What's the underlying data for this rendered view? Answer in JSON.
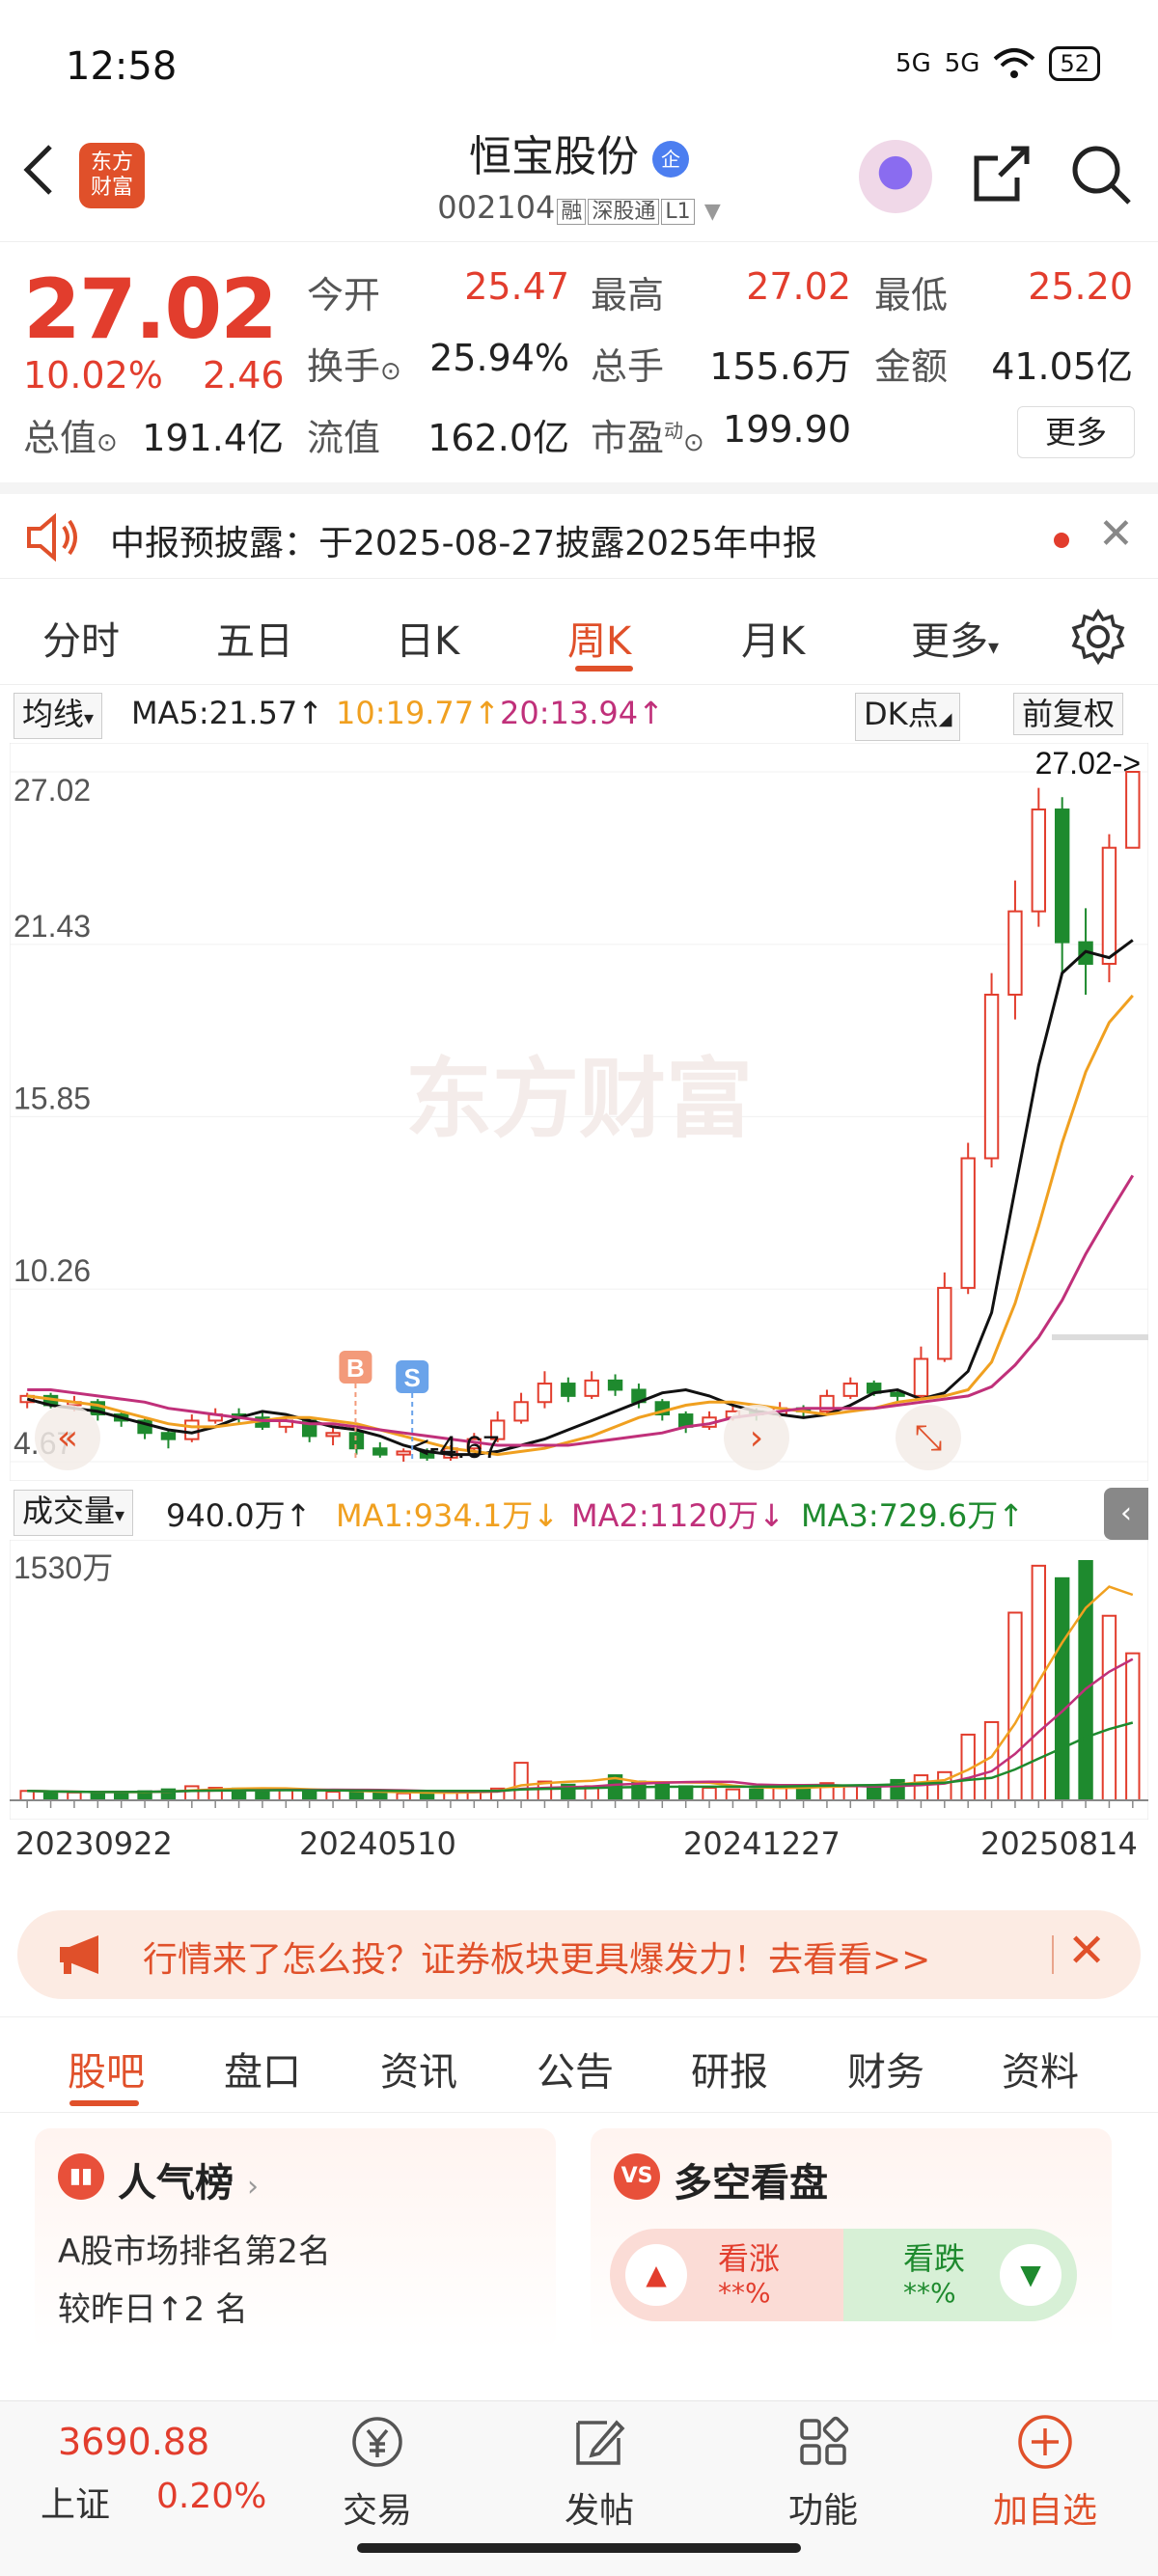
{
  "status": {
    "time": "12:58",
    "signal1": "5G",
    "signal2": "5G",
    "battery": "52"
  },
  "header": {
    "logo_line1": "东方",
    "logo_line2": "财富",
    "name": "恒宝股份",
    "name_badge": "企",
    "code": "002104",
    "tag_margin": "融",
    "tag_connect": "深股通",
    "tag_level": "L1"
  },
  "quote": {
    "last_price": "27.02",
    "pct_change": "10.02%",
    "change": "2.46",
    "open_label": "今开",
    "open": "25.47",
    "high_label": "最高",
    "high": "27.02",
    "low_label": "最低",
    "low": "25.20",
    "turnover_label": "换手",
    "turnover": "25.94%",
    "volume_label": "总手",
    "volume": "155.6万",
    "amount_label": "金额",
    "amount": "41.05亿",
    "mcap_label": "总值",
    "mcap": "191.4亿",
    "float_label": "流值",
    "float_mcap": "162.0亿",
    "pe_label": "市盈",
    "pe_sup": "动",
    "pe": "199.90",
    "more": "更多"
  },
  "notice": {
    "text": "中报预披露：于2025-08-27披露2025年中报"
  },
  "period_tabs": [
    "分时",
    "五日",
    "日K",
    "周K",
    "月K",
    "更多"
  ],
  "active_period": "周K",
  "ma_row": {
    "selector": "均线",
    "ma5": "MA5:21.57↑",
    "ma10": "10:19.77↑",
    "ma20": "20:13.94↑",
    "dk": "DK点",
    "adjust": "前复权"
  },
  "colors": {
    "up": "#e23d2d",
    "down": "#1e8a2e",
    "ma5": "#111111",
    "ma10": "#f0a020",
    "ma20": "#c0307a",
    "accent": "#e0502a"
  },
  "chart_data": [
    {
      "type": "candlestick",
      "title": "",
      "y_ticks": [
        "27.02",
        "21.43",
        "15.85",
        "10.26",
        "4.67"
      ],
      "ylim": [
        4.67,
        27.02
      ],
      "x_ticks": [
        "20230922",
        "20240510",
        "20241227",
        "20250814"
      ],
      "annotations": {
        "high_marker": "27.02->",
        "low_marker": "<-4.67",
        "buy": "B",
        "sell": "S"
      },
      "watermark": "东方财富",
      "series": [
        {
          "name": "MA5",
          "values": [
            6.7,
            6.5,
            6.4,
            6.3,
            6.1,
            5.9,
            5.7,
            5.6,
            5.8,
            6.1,
            6.3,
            6.2,
            6.0,
            5.8,
            5.7,
            5.5,
            5.2,
            5.0,
            4.9,
            4.9,
            5.0,
            5.2,
            5.4,
            5.7,
            6.0,
            6.3,
            6.6,
            6.9,
            7.0,
            6.8,
            6.5,
            6.3,
            6.2,
            6.1,
            6.2,
            6.5,
            6.9,
            7.0,
            6.7,
            6.9,
            7.6,
            9.5,
            13.5,
            17.5,
            20.5,
            21.2,
            21.0,
            21.57
          ]
        },
        {
          "name": "MA10",
          "values": [
            6.8,
            6.7,
            6.6,
            6.5,
            6.3,
            6.1,
            5.9,
            5.8,
            5.8,
            5.9,
            6.0,
            6.1,
            6.1,
            6.0,
            5.9,
            5.7,
            5.5,
            5.3,
            5.1,
            5.0,
            4.9,
            5.0,
            5.1,
            5.3,
            5.5,
            5.8,
            6.1,
            6.3,
            6.5,
            6.6,
            6.6,
            6.5,
            6.4,
            6.3,
            6.2,
            6.3,
            6.4,
            6.6,
            6.7,
            6.8,
            7.0,
            7.9,
            9.8,
            12.3,
            15.0,
            17.3,
            18.9,
            19.77
          ]
        },
        {
          "name": "MA20",
          "values": [
            7.0,
            7.0,
            6.9,
            6.8,
            6.7,
            6.6,
            6.4,
            6.3,
            6.2,
            6.1,
            6.0,
            6.0,
            5.9,
            5.9,
            5.8,
            5.7,
            5.6,
            5.5,
            5.4,
            5.3,
            5.2,
            5.2,
            5.2,
            5.2,
            5.3,
            5.4,
            5.5,
            5.6,
            5.8,
            5.9,
            6.1,
            6.2,
            6.3,
            6.4,
            6.4,
            6.4,
            6.4,
            6.5,
            6.6,
            6.7,
            6.8,
            7.1,
            7.8,
            8.7,
            9.9,
            11.4,
            12.7,
            13.94
          ]
        }
      ],
      "candles": [
        [
          6.6,
          6.8,
          6.4,
          6.9
        ],
        [
          6.8,
          6.5,
          6.4,
          6.9
        ],
        [
          6.5,
          6.6,
          6.3,
          6.8
        ],
        [
          6.6,
          6.2,
          6.0,
          6.7
        ],
        [
          6.2,
          6.0,
          5.8,
          6.3
        ],
        [
          6.0,
          5.6,
          5.4,
          6.1
        ],
        [
          5.6,
          5.4,
          5.1,
          5.7
        ],
        [
          5.4,
          6.0,
          5.3,
          6.2
        ],
        [
          6.0,
          6.2,
          5.9,
          6.4
        ],
        [
          6.2,
          6.1,
          5.9,
          6.4
        ],
        [
          6.1,
          5.8,
          5.7,
          6.3
        ],
        [
          5.8,
          6.0,
          5.6,
          6.1
        ],
        [
          6.0,
          5.5,
          5.3,
          6.1
        ],
        [
          5.5,
          5.6,
          5.2,
          5.8
        ],
        [
          5.6,
          5.1,
          4.9,
          5.7
        ],
        [
          5.1,
          4.9,
          4.8,
          5.3
        ],
        [
          4.9,
          5.0,
          4.67,
          5.1
        ],
        [
          5.0,
          4.8,
          4.7,
          5.1
        ],
        [
          4.8,
          5.1,
          4.7,
          5.2
        ],
        [
          5.1,
          5.4,
          5.0,
          5.6
        ],
        [
          5.4,
          6.0,
          5.3,
          6.3
        ],
        [
          6.0,
          6.6,
          5.9,
          6.9
        ],
        [
          6.6,
          7.2,
          6.4,
          7.6
        ],
        [
          7.2,
          6.8,
          6.6,
          7.4
        ],
        [
          6.8,
          7.3,
          6.7,
          7.6
        ],
        [
          7.3,
          7.0,
          6.8,
          7.5
        ],
        [
          7.0,
          6.6,
          6.4,
          7.2
        ],
        [
          6.6,
          6.2,
          6.0,
          6.7
        ],
        [
          6.2,
          5.8,
          5.6,
          6.3
        ],
        [
          5.8,
          6.1,
          5.7,
          6.3
        ],
        [
          6.1,
          6.3,
          6.0,
          6.5
        ],
        [
          6.3,
          6.2,
          6.0,
          6.4
        ],
        [
          6.2,
          6.4,
          6.1,
          6.6
        ],
        [
          6.4,
          6.3,
          6.1,
          6.5
        ],
        [
          6.3,
          6.8,
          6.2,
          7.0
        ],
        [
          6.8,
          7.2,
          6.7,
          7.4
        ],
        [
          7.2,
          6.9,
          6.8,
          7.3
        ],
        [
          6.9,
          6.8,
          6.6,
          7.0
        ],
        [
          6.8,
          8.0,
          6.7,
          8.4
        ],
        [
          8.0,
          10.3,
          7.9,
          10.8
        ],
        [
          10.3,
          14.5,
          10.1,
          15.0
        ],
        [
          14.5,
          19.8,
          14.2,
          20.5
        ],
        [
          19.8,
          22.5,
          19.0,
          23.5
        ],
        [
          22.5,
          25.8,
          22.0,
          26.5
        ],
        [
          25.8,
          21.5,
          20.5,
          26.2
        ],
        [
          21.5,
          20.8,
          19.8,
          22.6
        ],
        [
          20.8,
          24.56,
          20.2,
          25.0
        ],
        [
          24.56,
          27.02,
          25.2,
          27.02
        ]
      ]
    },
    {
      "type": "bar",
      "title": "",
      "ylabel": "成交量",
      "y_ticks": [
        "1530万"
      ],
      "ylim": [
        0,
        1530
      ],
      "series": [
        {
          "name": "MA1",
          "last": "934.1万"
        },
        {
          "name": "MA2",
          "last": "1120万"
        },
        {
          "name": "MA3",
          "last": "729.6万"
        }
      ],
      "values": [
        60,
        55,
        50,
        48,
        52,
        58,
        70,
        90,
        80,
        75,
        70,
        66,
        60,
        55,
        50,
        48,
        45,
        50,
        52,
        60,
        75,
        240,
        120,
        100,
        90,
        160,
        120,
        110,
        90,
        80,
        70,
        70,
        85,
        95,
        110,
        90,
        85,
        130,
        160,
        180,
        420,
        500,
        1200,
        1500,
        1420,
        1530,
        1180,
        940
      ],
      "up": [
        1,
        0,
        1,
        0,
        0,
        0,
        0,
        1,
        1,
        0,
        0,
        1,
        0,
        1,
        0,
        0,
        1,
        0,
        1,
        1,
        1,
        1,
        1,
        0,
        1,
        0,
        0,
        0,
        0,
        1,
        1,
        0,
        1,
        0,
        1,
        1,
        0,
        0,
        1,
        1,
        1,
        1,
        1,
        1,
        0,
        0,
        1,
        1
      ]
    }
  ],
  "volume_row": {
    "selector": "成交量",
    "current": "940.0万↑",
    "ma1": "MA1:934.1万↓",
    "ma2": "MA2:1120万↓",
    "ma3": "MA3:729.6万↑"
  },
  "promo": {
    "text": "行情来了怎么投？证券板块更具爆发力！去看看>>"
  },
  "content_tabs": [
    "股吧",
    "盘口",
    "资讯",
    "公告",
    "研报",
    "财务",
    "资料"
  ],
  "popular_card": {
    "title": "人气榜",
    "line1": "A股市场排名第2名",
    "line2": "较昨日↑2 名"
  },
  "bullbear_card": {
    "icon": "VS",
    "title": "多空看盘",
    "up_label": "看涨",
    "up_value": "**%",
    "down_label": "看跌",
    "down_value": "**%"
  },
  "bottom_bar": {
    "index_value": "3690.88",
    "index_name": "上证",
    "index_pct": "0.20%",
    "nav": [
      "交易",
      "发帖",
      "功能",
      "加自选"
    ]
  }
}
